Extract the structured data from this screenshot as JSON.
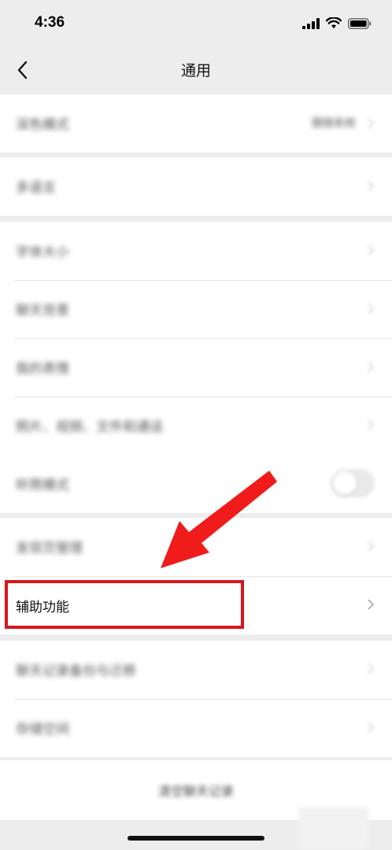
{
  "status_bar": {
    "time": "4:36"
  },
  "nav": {
    "title": "通用",
    "back_icon": "chevron-left-icon"
  },
  "groups": [
    {
      "items": [
        {
          "label": "深色模式",
          "value": "跟随系统"
        }
      ]
    },
    {
      "items": [
        {
          "label": "多语言",
          "value": ""
        }
      ]
    },
    {
      "items": [
        {
          "label": "字体大小",
          "value": ""
        },
        {
          "label": "聊天背景",
          "value": ""
        },
        {
          "label": "我的表情",
          "value": ""
        },
        {
          "label": "照片、视频、文件和通话",
          "value": ""
        }
      ]
    },
    {
      "items": [
        {
          "label": "听筒模式",
          "toggle": false
        }
      ]
    },
    {
      "items": [
        {
          "label": "发现页管理",
          "value": ""
        },
        {
          "label": "辅助功能",
          "value": ""
        }
      ]
    },
    {
      "items": [
        {
          "label": "聊天记录备份与迁移",
          "value": ""
        },
        {
          "label": "存储空间",
          "value": ""
        }
      ]
    }
  ],
  "clear_chat": {
    "label": "清空聊天记录"
  },
  "annotation": {
    "highlight_color": "#d9161b",
    "arrow_color": "#f01b1b"
  },
  "colors": {
    "background": "#ededed",
    "card": "#ffffff",
    "text": "#111111"
  }
}
